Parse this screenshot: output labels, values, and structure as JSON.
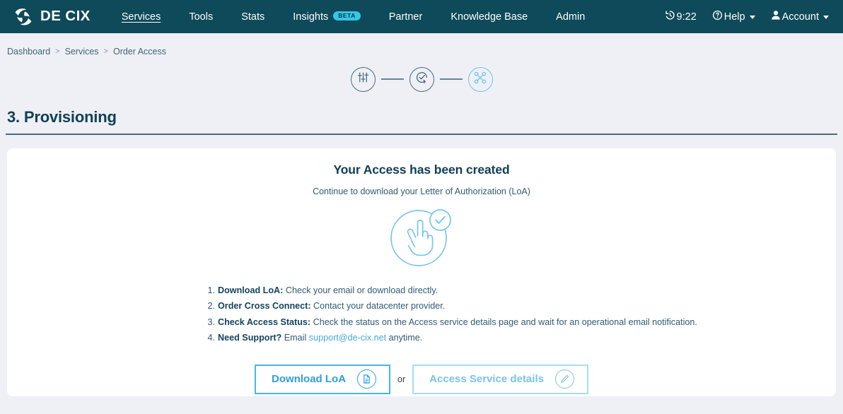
{
  "nav": {
    "brand": "DE CIX",
    "brand_icon": "de-cix-logo-icon",
    "items": [
      {
        "label": "Services",
        "active": true
      },
      {
        "label": "Tools",
        "active": false
      },
      {
        "label": "Stats",
        "active": false
      },
      {
        "label": "Insights",
        "active": false,
        "badge": "BETA"
      },
      {
        "label": "Partner",
        "active": false
      },
      {
        "label": "Knowledge Base",
        "active": false
      },
      {
        "label": "Admin",
        "active": false
      }
    ],
    "right": {
      "time": "9:22",
      "time_icon": "history-clock-icon",
      "help": "Help",
      "help_icon": "question-circle-icon",
      "account": "Account",
      "account_icon": "user-icon"
    }
  },
  "breadcrumb": {
    "items": [
      "Dashboard",
      "Services",
      "Order Access"
    ],
    "separator": ">"
  },
  "stepper": {
    "steps": [
      {
        "name": "configure",
        "icon": "sliders-icon",
        "active": false
      },
      {
        "name": "validate",
        "icon": "check-circle-arrow-icon",
        "active": false
      },
      {
        "name": "provisioning",
        "icon": "cross-connect-icon",
        "active": true
      }
    ]
  },
  "page": {
    "title": "3. Provisioning"
  },
  "card": {
    "heading": "Your Access has been created",
    "subheading": "Continue to download your Letter of Authorization (LoA)",
    "hero_icon": "victory-hand-success-icon",
    "steps": [
      {
        "bold": "Download LoA:",
        "text": " Check your email or download directly."
      },
      {
        "bold": "Order Cross Connect:",
        "text": " Contact your datacenter provider."
      },
      {
        "bold": "Check Access Status:",
        "text": " Check the status on the Access service details page and wait for an operational email notification."
      },
      {
        "bold": "Need Support?",
        "text": " Email ",
        "link": "support@de-cix.net",
        "text_after": " anytime."
      }
    ],
    "actions": {
      "primary_label": "Download LoA",
      "primary_icon": "document-download-icon",
      "or": "or",
      "secondary_label": "Access Service details",
      "secondary_icon": "pencil-edit-icon"
    }
  },
  "colors": {
    "nav_background": "#0e4a5a",
    "page_background": "#eef0f5",
    "card_background": "#ffffff",
    "accent_blue": "#2e9fe0",
    "accent_light_blue": "#79c4ea",
    "beta_badge": "#35c6e8",
    "heading": "#124054",
    "link": "#4aa8dd"
  }
}
